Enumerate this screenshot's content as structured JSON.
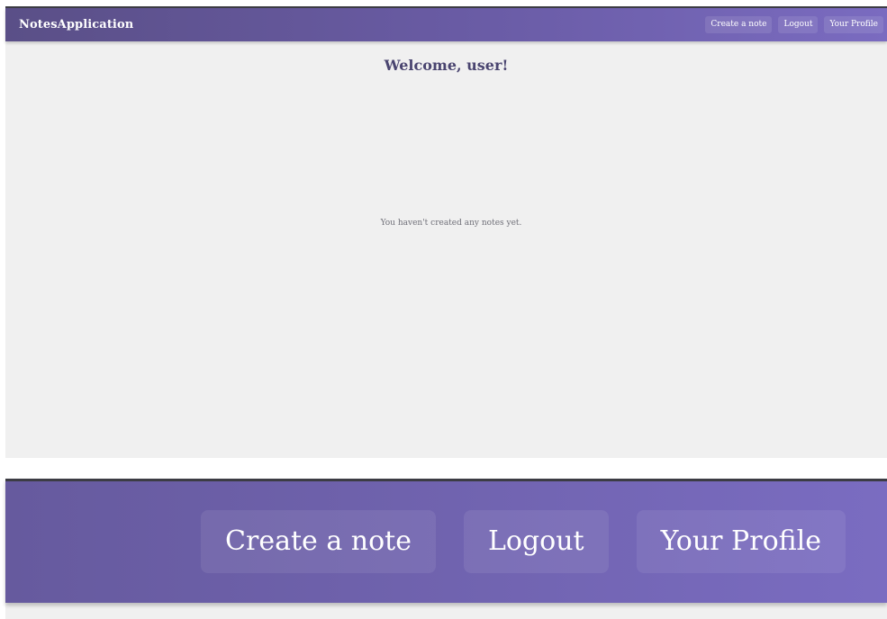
{
  "navbar": {
    "brand": "NotesApplication",
    "actions": [
      {
        "label": "Create a note"
      },
      {
        "label": "Logout"
      },
      {
        "label": "Your Profile"
      }
    ]
  },
  "main": {
    "welcome": "Welcome, user!",
    "empty_message": "You haven't created any notes yet."
  },
  "zoom_navbar": {
    "actions": [
      {
        "label": "Create a note"
      },
      {
        "label": "Logout"
      },
      {
        "label": "Your Profile"
      }
    ]
  },
  "colors": {
    "navbar_start": "#5a4f87",
    "navbar_end": "#7a6bc0",
    "page_background": "#f0f0f0",
    "heading_text": "#4a4570",
    "muted_text": "#6f6f78"
  }
}
